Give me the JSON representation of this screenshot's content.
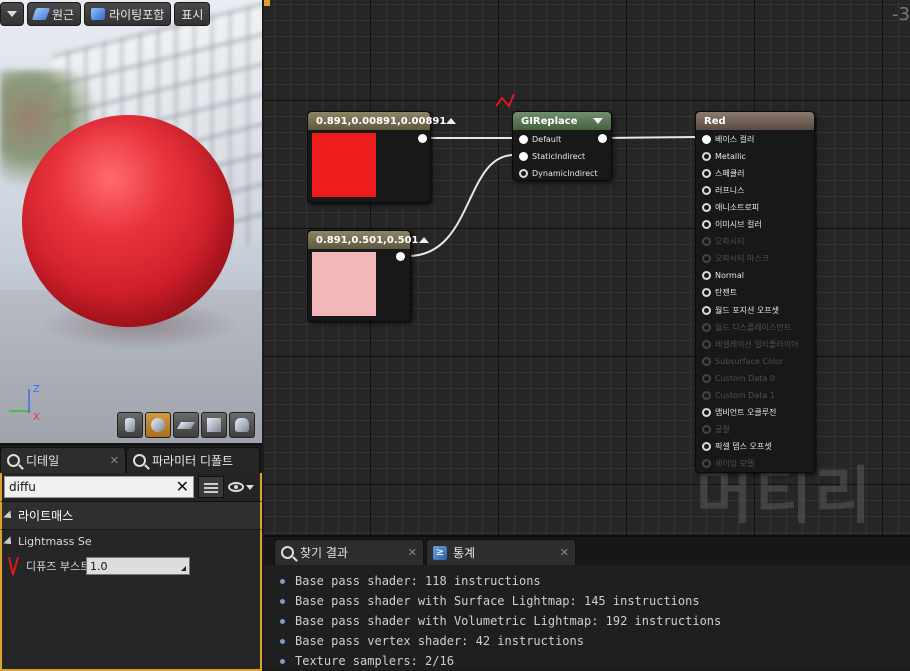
{
  "viewport": {
    "toolbar": {
      "perspective_label": "원근",
      "lit_label": "라이팅포함",
      "show_label": "표시"
    },
    "axis": {
      "z": "Z",
      "x": "X"
    }
  },
  "details": {
    "tabs": [
      {
        "label": "디테일"
      },
      {
        "label": "파라미터 디폴트"
      }
    ],
    "search": {
      "value": "diffu"
    },
    "section_title": "라이트매스",
    "subsection_title": "Lightmass Se",
    "property": {
      "name": "디퓨즈 부스트",
      "value": "1.0"
    }
  },
  "graph": {
    "watermark": "머티리얼",
    "corner_number": "-3",
    "nodes": {
      "color1": {
        "title": "0.891,0.00891,0.00891",
        "swatch": "#ee1c1c"
      },
      "color2": {
        "title": "0.891,0.501,0.501",
        "swatch": "#f2b8b9"
      },
      "gireplace": {
        "title": "GIReplace",
        "pins": [
          "Default",
          "StaticIndirect",
          "DynamicIndirect"
        ]
      },
      "material": {
        "title": "Red",
        "pins": [
          {
            "label": "베이스 컬러",
            "state": "connected"
          },
          {
            "label": "Metallic",
            "state": "open"
          },
          {
            "label": "스페큘러",
            "state": "open"
          },
          {
            "label": "러프니스",
            "state": "open"
          },
          {
            "label": "애니소트로피",
            "state": "open"
          },
          {
            "label": "이미시브 컬러",
            "state": "open"
          },
          {
            "label": "오파시티",
            "state": "dim"
          },
          {
            "label": "오파시티 마스크",
            "state": "dim"
          },
          {
            "label": "Normal",
            "state": "open"
          },
          {
            "label": "탄젠트",
            "state": "open"
          },
          {
            "label": "월드 포지션 오프셋",
            "state": "open"
          },
          {
            "label": "월드 디스플레이스먼트",
            "state": "dim"
          },
          {
            "label": "테셀레이션 멀티플라이어",
            "state": "dim"
          },
          {
            "label": "Subsurface Color",
            "state": "dim"
          },
          {
            "label": "Custom Data 0",
            "state": "dim"
          },
          {
            "label": "Custom Data 1",
            "state": "dim"
          },
          {
            "label": "앰비언트 오클루전",
            "state": "open"
          },
          {
            "label": "굴절",
            "state": "dim"
          },
          {
            "label": "픽셀 뎁스 오프셋",
            "state": "open"
          },
          {
            "label": "셰이딩 모델",
            "state": "dim"
          }
        ]
      }
    }
  },
  "stats": {
    "tabs": [
      {
        "label": "찾기 결과"
      },
      {
        "label": "통계"
      }
    ],
    "lines": [
      "Base pass shader: 118 instructions",
      "Base pass shader with Surface Lightmap: 145 instructions",
      "Base pass shader with Volumetric Lightmap: 192 instructions",
      "Base pass vertex shader: 42 instructions",
      "Texture samplers: 2/16"
    ]
  }
}
